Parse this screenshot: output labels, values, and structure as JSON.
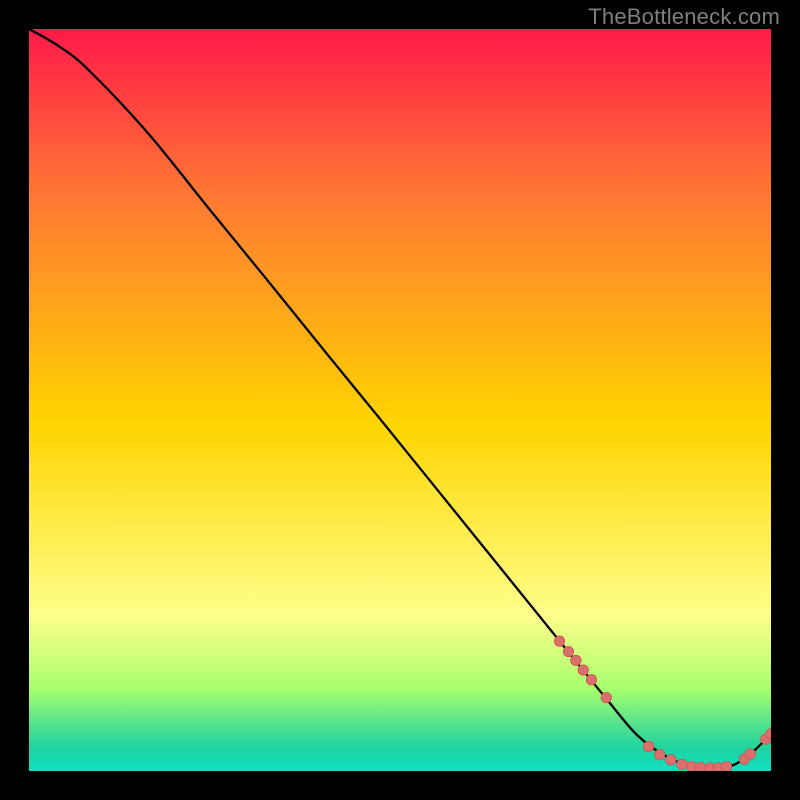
{
  "watermark": "TheBottleneck.com",
  "colors": {
    "grad_top": "#ff1a48",
    "grad_orange": "#ff7a33",
    "grad_yellow": "#ffd400",
    "grad_lightyellow": "#ffff8a",
    "grad_lime": "#a6ff6e",
    "grad_green1": "#4fe08f",
    "grad_green2": "#1fd3a0",
    "grad_bottom": "#0fe0c0",
    "curve": "#000000",
    "marker_fill": "#dc6f6b",
    "marker_stroke": "#c54d4a",
    "bg": "#000000"
  },
  "chart_data": {
    "type": "line",
    "title": "",
    "xlabel": "",
    "ylabel": "",
    "xlim": [
      0,
      100
    ],
    "ylim": [
      0,
      100
    ],
    "series": [
      {
        "name": "bottleneck-curve",
        "x": [
          0,
          4,
          8,
          16,
          24,
          32,
          40,
          48,
          56,
          64,
          72,
          78,
          82,
          86,
          90,
          94,
          97,
          100
        ],
        "y": [
          100,
          97.7,
          94.5,
          86.0,
          76.1,
          66.3,
          56.4,
          46.6,
          36.7,
          26.8,
          16.9,
          9.5,
          4.8,
          1.9,
          0.5,
          0.5,
          2.1,
          5.0
        ]
      }
    ],
    "markers": [
      {
        "name": "cluster-descent",
        "points": [
          {
            "x": 71.5,
            "y": 17.5
          },
          {
            "x": 72.7,
            "y": 16.1
          },
          {
            "x": 73.7,
            "y": 14.9
          },
          {
            "x": 74.7,
            "y": 13.6
          },
          {
            "x": 75.8,
            "y": 12.3
          },
          {
            "x": 77.8,
            "y": 9.9
          }
        ]
      },
      {
        "name": "cluster-trough",
        "points": [
          {
            "x": 83.5,
            "y": 3.3
          },
          {
            "x": 85.0,
            "y": 2.2
          },
          {
            "x": 86.5,
            "y": 1.5
          },
          {
            "x": 88.0,
            "y": 0.9
          },
          {
            "x": 89.3,
            "y": 0.6
          },
          {
            "x": 90.5,
            "y": 0.5
          },
          {
            "x": 91.8,
            "y": 0.4
          },
          {
            "x": 92.9,
            "y": 0.4
          },
          {
            "x": 94.0,
            "y": 0.6
          }
        ]
      },
      {
        "name": "cluster-rise",
        "points": [
          {
            "x": 96.4,
            "y": 1.6
          },
          {
            "x": 97.2,
            "y": 2.3
          },
          {
            "x": 99.3,
            "y": 4.3
          },
          {
            "x": 100.0,
            "y": 5.0
          }
        ]
      }
    ]
  }
}
